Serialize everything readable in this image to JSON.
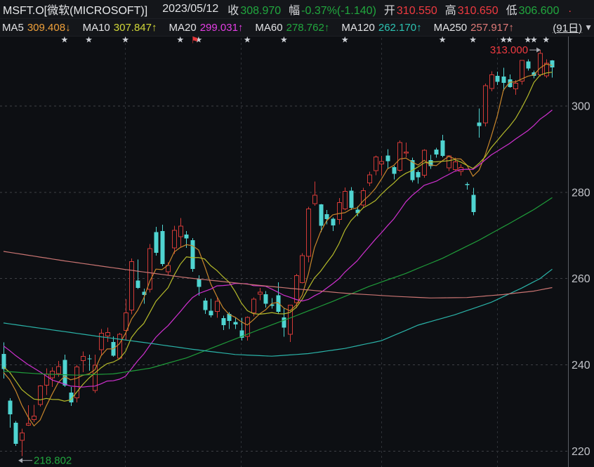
{
  "header": {
    "symbol": "MSFT.O[微软(MICROSOFT)]",
    "date": "2023/05/12",
    "quote": [
      {
        "label": "收",
        "value": "308.970",
        "tone": "down"
      },
      {
        "label": "幅",
        "value": "-0.37%(-1.140)",
        "tone": "down"
      },
      {
        "label": "开",
        "value": "310.550",
        "tone": "up"
      },
      {
        "label": "高",
        "value": "310.650",
        "tone": "up"
      },
      {
        "label": "低",
        "value": "306.600",
        "tone": "down"
      }
    ],
    "clipped_fragment": ".",
    "period_label": "(91日)",
    "dropdown_icon": "▼"
  },
  "ma_legend": [
    {
      "label": "MA5",
      "value": "309.408",
      "arrow": "↓",
      "color": "#f0a13a"
    },
    {
      "label": "MA10",
      "value": "307.847",
      "arrow": "↑",
      "color": "#d2d838"
    },
    {
      "label": "MA20",
      "value": "299.031",
      "arrow": "↑",
      "color": "#e43ee4"
    },
    {
      "label": "MA60",
      "value": "278.762",
      "arrow": "↑",
      "color": "#21a73e"
    },
    {
      "label": "MA120",
      "value": "262.170",
      "arrow": "↑",
      "color": "#2cc3b2"
    },
    {
      "label": "MA250",
      "value": "257.917",
      "arrow": "↑",
      "color": "#e07a78"
    }
  ],
  "chart_data": {
    "type": "candlestick",
    "title": "MSFT.O daily candles with MA overlays",
    "ylim": [
      216.5,
      315
    ],
    "axis": {
      "side": "right",
      "ticks": [
        300,
        280,
        260,
        240,
        220
      ]
    },
    "x_count": 91,
    "candles": [
      [
        242.5,
        245.2,
        236.8,
        239.0
      ],
      [
        231.7,
        232.3,
        225.4,
        228.5
      ],
      [
        226.6,
        227.0,
        221.2,
        221.7
      ],
      [
        222.4,
        225.2,
        218.802,
        224.3
      ],
      [
        225.9,
        230.6,
        225.8,
        226.5
      ],
      [
        227.2,
        230.7,
        226.7,
        228.2
      ],
      [
        230.7,
        235.3,
        230.3,
        235.2
      ],
      [
        235.2,
        239.2,
        233.0,
        237.9
      ],
      [
        236.9,
        239.4,
        234.9,
        238.6
      ],
      [
        237.9,
        240.9,
        237.2,
        239.7
      ],
      [
        241.1,
        242.4,
        234.9,
        235.2
      ],
      [
        233.6,
        234.9,
        230.5,
        231.3
      ],
      [
        232.3,
        240.0,
        231.3,
        239.6
      ],
      [
        240.9,
        243.1,
        238.3,
        242.0
      ],
      [
        241.5,
        242.4,
        238.6,
        241.4
      ],
      [
        234.0,
        242.4,
        233.5,
        240.0
      ],
      [
        243.4,
        248.3,
        242.2,
        247.4
      ],
      [
        246.6,
        248.6,
        245.3,
        247.6
      ],
      [
        245.3,
        246.6,
        241.9,
        242.1
      ],
      [
        241.5,
        247.4,
        241.4,
        247.2
      ],
      [
        247.9,
        255.2,
        245.8,
        252.1
      ],
      [
        252.6,
        264.7,
        251.7,
        264.0
      ],
      [
        259.5,
        264.4,
        257.6,
        257.8
      ],
      [
        256.9,
        257.7,
        254.2,
        256.2
      ],
      [
        257.4,
        268.0,
        256.8,
        267.0
      ],
      [
        270.8,
        272.0,
        265.3,
        266.0
      ],
      [
        271.0,
        272.5,
        262.9,
        263.4
      ],
      [
        261.5,
        263.8,
        260.7,
        263.1
      ],
      [
        267.0,
        272.2,
        265.7,
        271.3
      ],
      [
        269.6,
        274.0,
        267.2,
        272.2
      ],
      [
        270.2,
        271.0,
        267.1,
        269.3
      ],
      [
        268.9,
        269.4,
        261.6,
        262.2
      ],
      [
        259.9,
        260.8,
        256.0,
        258.1
      ],
      [
        254.9,
        255.5,
        251.8,
        252.7
      ],
      [
        252.5,
        255.3,
        251.0,
        251.5
      ],
      [
        252.3,
        255.8,
        250.9,
        254.8
      ],
      [
        250.8,
        251.4,
        248.1,
        249.2
      ],
      [
        251.8,
        252.2,
        248.3,
        250.2
      ],
      [
        249.9,
        251.0,
        248.3,
        249.4
      ],
      [
        248.0,
        250.9,
        245.6,
        246.3
      ],
      [
        246.5,
        251.2,
        245.6,
        251.1
      ],
      [
        252.0,
        255.6,
        251.2,
        255.3
      ],
      [
        256.3,
        257.8,
        255.0,
        256.9
      ],
      [
        256.4,
        257.1,
        253.3,
        254.2
      ],
      [
        254.0,
        255.5,
        253.0,
        253.7
      ],
      [
        256.1,
        259.1,
        251.8,
        252.3
      ],
      [
        251.0,
        253.0,
        246.5,
        248.6
      ],
      [
        247.0,
        253.9,
        245.3,
        253.9
      ],
      [
        254.3,
        261.1,
        253.2,
        260.8
      ],
      [
        259.0,
        265.9,
        258.9,
        265.4
      ],
      [
        265.1,
        276.6,
        263.8,
        276.2
      ],
      [
        277.3,
        282.5,
        276.9,
        279.4
      ],
      [
        277.2,
        277.3,
        270.8,
        272.2
      ],
      [
        274.9,
        275.9,
        272.6,
        273.8
      ],
      [
        273.9,
        274.2,
        271.0,
        272.3
      ],
      [
        273.6,
        278.7,
        272.6,
        277.7
      ],
      [
        276.1,
        281.1,
        275.8,
        280.3
      ],
      [
        280.4,
        281.2,
        275.9,
        276.4
      ],
      [
        276.0,
        276.8,
        274.4,
        275.2
      ],
      [
        277.0,
        281.0,
        276.5,
        280.5
      ],
      [
        282.1,
        284.8,
        281.4,
        284.1
      ],
      [
        284.9,
        288.5,
        284.0,
        288.3
      ],
      [
        286.5,
        288.4,
        283.9,
        287.2
      ],
      [
        288.5,
        290.0,
        285.4,
        287.2
      ],
      [
        285.8,
        286.2,
        283.0,
        284.3
      ],
      [
        285.0,
        292.0,
        284.8,
        291.6
      ],
      [
        289.0,
        291.5,
        288.1,
        289.4
      ],
      [
        287.5,
        288.0,
        282.3,
        282.8
      ],
      [
        284.7,
        285.1,
        282.0,
        283.5
      ],
      [
        283.9,
        290.0,
        283.4,
        289.8
      ],
      [
        287.5,
        288.7,
        285.4,
        286.1
      ],
      [
        289.9,
        290.3,
        288.0,
        288.8
      ],
      [
        292.0,
        293.3,
        288.1,
        288.4
      ],
      [
        285.6,
        288.6,
        284.9,
        288.5
      ],
      [
        285.2,
        288.0,
        285.0,
        287.1
      ],
      [
        284.8,
        286.5,
        283.9,
        285.8
      ],
      [
        281.9,
        282.3,
        280.6,
        281.8
      ],
      [
        279.4,
        281.0,
        274.7,
        275.4
      ],
      [
        296.2,
        299.4,
        292.7,
        295.4
      ],
      [
        296.0,
        305.2,
        295.3,
        304.8
      ],
      [
        304.0,
        308.1,
        303.4,
        307.3
      ],
      [
        307.0,
        308.0,
        304.9,
        305.6
      ],
      [
        306.8,
        308.9,
        303.6,
        305.4
      ],
      [
        306.2,
        307.3,
        304.2,
        304.4
      ],
      [
        303.9,
        306.0,
        302.6,
        305.4
      ],
      [
        305.7,
        310.7,
        305.0,
        310.65
      ],
      [
        310.3,
        310.8,
        308.2,
        308.7
      ],
      [
        307.8,
        308.2,
        306.4,
        307.0
      ],
      [
        307.2,
        313.0,
        306.8,
        312.3
      ],
      [
        306.9,
        310.8,
        306.5,
        310.0
      ],
      [
        310.55,
        310.65,
        306.6,
        308.97
      ]
    ],
    "prehistory_closes": [
      250.2,
      245.1,
      244.4,
      247.4,
      245.4,
      252.5,
      256.9,
      257.2,
      249.0,
      244.7,
      240.5,
      241.8,
      244.4,
      238.2,
      238.7,
      237.0,
      234.5,
      241.0,
      239.8
    ],
    "computed_ma_periods": [
      5,
      10,
      20
    ],
    "ma_overlays": [
      {
        "name": "MA60",
        "color_key": "ma60",
        "points": [
          [
            0,
            238.5
          ],
          [
            6,
            237.9
          ],
          [
            12,
            237.6
          ],
          [
            18,
            237.9
          ],
          [
            24,
            239.2
          ],
          [
            30,
            241.6
          ],
          [
            36,
            244.9
          ],
          [
            42,
            248.2
          ],
          [
            48,
            251.4
          ],
          [
            54,
            254.7
          ],
          [
            60,
            258.2
          ],
          [
            66,
            261.2
          ],
          [
            72,
            264.7
          ],
          [
            78,
            268.9
          ],
          [
            83,
            272.8
          ],
          [
            87,
            276.0
          ],
          [
            90,
            278.762
          ]
        ]
      },
      {
        "name": "MA120",
        "color_key": "ma120",
        "points": [
          [
            0,
            249.7
          ],
          [
            8,
            248.1
          ],
          [
            16,
            246.5
          ],
          [
            24,
            245.0
          ],
          [
            31,
            243.6
          ],
          [
            38,
            242.4
          ],
          [
            44,
            242.0
          ],
          [
            50,
            242.6
          ],
          [
            56,
            243.8
          ],
          [
            62,
            245.6
          ],
          [
            68,
            249.2
          ],
          [
            74,
            251.6
          ],
          [
            80,
            254.5
          ],
          [
            85,
            257.8
          ],
          [
            88,
            260.0
          ],
          [
            90,
            262.17
          ]
        ]
      },
      {
        "name": "MA250",
        "color_key": "ma250",
        "points": [
          [
            0,
            266.3
          ],
          [
            10,
            264.1
          ],
          [
            20,
            262.1
          ],
          [
            30,
            260.2
          ],
          [
            40,
            258.7
          ],
          [
            48,
            257.6
          ],
          [
            56,
            256.6
          ],
          [
            64,
            255.9
          ],
          [
            70,
            255.5
          ],
          [
            76,
            255.6
          ],
          [
            82,
            256.3
          ],
          [
            87,
            257.1
          ],
          [
            90,
            257.917
          ]
        ]
      }
    ],
    "star_indices": [
      10,
      14,
      20,
      29,
      32,
      40,
      46,
      56,
      72,
      77,
      82,
      83,
      86,
      87,
      89
    ],
    "flag_index": 31.4,
    "month_grid_indices": [
      20,
      39,
      62,
      81
    ],
    "annotations": {
      "high": {
        "text": "313.000",
        "index": 88,
        "price": 313.0
      },
      "low": {
        "text": "218.802",
        "index": 3,
        "price": 218.802
      }
    },
    "colors": {
      "up": "#d23a37",
      "down": "#4fd4d1",
      "background": "#0d0f13",
      "grid_h": "#3e4046",
      "grid_v": "#2e3137",
      "axis_line": "#5a5d64",
      "tick_text": "#c2c4c9",
      "ma5": "#c8862b",
      "ma10": "#b5ba2a",
      "ma20": "#cf30cf",
      "ma60": "#1f9c3a",
      "ma120": "#2ab3a8",
      "ma250": "#c97472",
      "star": "#cdd0d6",
      "flag": "#e5383b",
      "high_label": "#ef3a40",
      "low_label": "#21a73e",
      "arrow": "#a7aab1"
    }
  }
}
